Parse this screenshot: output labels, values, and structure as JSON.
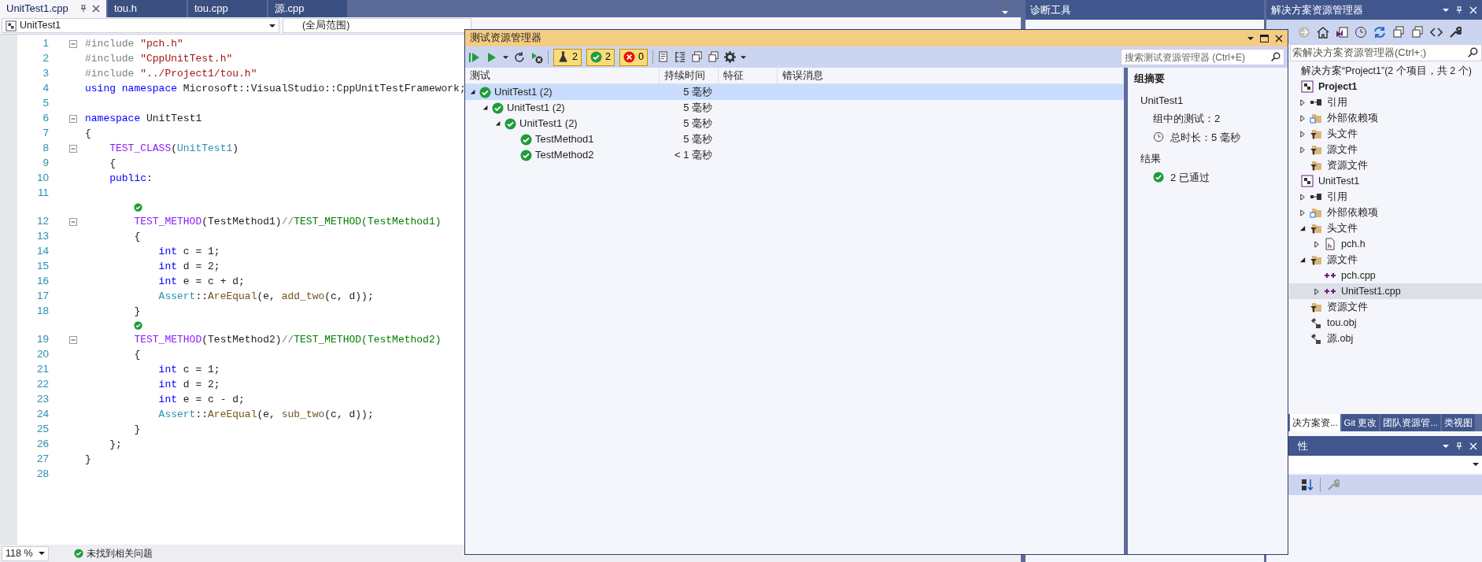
{
  "editor": {
    "tabs": [
      {
        "label": "UnitTest1.cpp",
        "selected": true
      },
      {
        "label": "tou.h",
        "selected": false
      },
      {
        "label": "tou.cpp",
        "selected": false
      },
      {
        "label": "源.cpp",
        "selected": false
      }
    ],
    "nav": {
      "project": "UnitTest1",
      "scope": "(全局范围)"
    },
    "lines": [
      {
        "number": "1",
        "fold": true,
        "tokens": [
          {
            "kind": "directive",
            "text": "#include "
          },
          {
            "kind": "string",
            "text": "\"pch.h\""
          }
        ]
      },
      {
        "number": "2",
        "tokens": [
          {
            "kind": "directive",
            "text": "#include "
          },
          {
            "kind": "string",
            "text": "\"CppUnitTest.h\""
          }
        ]
      },
      {
        "number": "3",
        "tokens": [
          {
            "kind": "directive",
            "text": "#include "
          },
          {
            "kind": "string",
            "text": "\"../Project1/tou.h\""
          }
        ]
      },
      {
        "number": "4",
        "tokens": [
          {
            "kind": "keyword",
            "text": "using"
          },
          {
            "kind": "keyword",
            "text": " namespace"
          },
          {
            "kind": "plain",
            "text": " Microsoft::VisualStudio::CppUnitTestFramework;"
          }
        ]
      },
      {
        "number": "5"
      },
      {
        "number": "6",
        "fold": true,
        "tokens": [
          {
            "kind": "keyword",
            "text": "namespace"
          },
          {
            "kind": "plain",
            "text": " UnitTest1"
          }
        ]
      },
      {
        "number": "7",
        "tokens": [
          {
            "kind": "plain",
            "text": "{"
          }
        ]
      },
      {
        "number": "8",
        "fold": true,
        "tokens": [
          {
            "kind": "macro",
            "text": "    TEST_CLASS"
          },
          {
            "kind": "plain",
            "text": "("
          },
          {
            "kind": "type",
            "text": "UnitTest1"
          },
          {
            "kind": "plain",
            "text": ")"
          }
        ]
      },
      {
        "number": "9",
        "tokens": [
          {
            "kind": "plain",
            "text": "    {"
          }
        ]
      },
      {
        "number": "10",
        "tokens": [
          {
            "kind": "keyword",
            "text": "    public"
          },
          {
            "kind": "plain",
            "text": ":"
          }
        ]
      },
      {
        "number": "11"
      },
      {
        "number": "12",
        "fold": true,
        "test_passed": true,
        "tokens": [
          {
            "kind": "macro",
            "text": "        TEST_METHOD"
          },
          {
            "kind": "plain",
            "text": "(TestMethod1)"
          },
          {
            "kind": "directive",
            "text": "//"
          },
          {
            "kind": "comment",
            "text": "TEST_METHOD(TestMethod1)"
          }
        ]
      },
      {
        "number": "13",
        "tokens": [
          {
            "kind": "plain",
            "text": "        {"
          }
        ]
      },
      {
        "number": "14",
        "tokens": [
          {
            "kind": "keyword",
            "text": "            int"
          },
          {
            "kind": "plain",
            "text": " c = 1;"
          }
        ]
      },
      {
        "number": "15",
        "tokens": [
          {
            "kind": "keyword",
            "text": "            int"
          },
          {
            "kind": "plain",
            "text": " d = 2;"
          }
        ]
      },
      {
        "number": "16",
        "tokens": [
          {
            "kind": "keyword",
            "text": "            int"
          },
          {
            "kind": "plain",
            "text": " e = c + d;"
          }
        ]
      },
      {
        "number": "17",
        "tokens": [
          {
            "kind": "type",
            "text": "            Assert"
          },
          {
            "kind": "plain",
            "text": "::"
          },
          {
            "kind": "function",
            "text": "AreEqual"
          },
          {
            "kind": "plain",
            "text": "(e, "
          },
          {
            "kind": "function",
            "text": "add_two"
          },
          {
            "kind": "plain",
            "text": "(c, d));"
          }
        ]
      },
      {
        "number": "18",
        "tokens": [
          {
            "kind": "plain",
            "text": "        }"
          }
        ]
      },
      {
        "number": "19",
        "fold": true,
        "test_passed": true,
        "tokens": [
          {
            "kind": "macro",
            "text": "        TEST_METHOD"
          },
          {
            "kind": "plain",
            "text": "(TestMethod2)"
          },
          {
            "kind": "directive",
            "text": "//"
          },
          {
            "kind": "comment",
            "text": "TEST_METHOD(TestMethod2)"
          }
        ]
      },
      {
        "number": "20",
        "tokens": [
          {
            "kind": "plain",
            "text": "        {"
          }
        ]
      },
      {
        "number": "21",
        "tokens": [
          {
            "kind": "keyword",
            "text": "            int"
          },
          {
            "kind": "plain",
            "text": " c = 1;"
          }
        ]
      },
      {
        "number": "22",
        "tokens": [
          {
            "kind": "keyword",
            "text": "            int"
          },
          {
            "kind": "plain",
            "text": " d = 2;"
          }
        ]
      },
      {
        "number": "23",
        "tokens": [
          {
            "kind": "keyword",
            "text": "            int"
          },
          {
            "kind": "plain",
            "text": " e = c - d;"
          }
        ]
      },
      {
        "number": "24",
        "tokens": [
          {
            "kind": "type",
            "text": "            Assert"
          },
          {
            "kind": "plain",
            "text": "::"
          },
          {
            "kind": "function",
            "text": "AreEqual"
          },
          {
            "kind": "plain",
            "text": "(e, "
          },
          {
            "kind": "function",
            "text": "sub_two"
          },
          {
            "kind": "plain",
            "text": "(c, d));"
          }
        ]
      },
      {
        "number": "25",
        "tokens": [
          {
            "kind": "plain",
            "text": "        }"
          }
        ]
      },
      {
        "number": "26",
        "tokens": [
          {
            "kind": "plain",
            "text": "    };"
          }
        ]
      },
      {
        "number": "27",
        "tokens": [
          {
            "kind": "plain",
            "text": "}"
          }
        ]
      },
      {
        "number": "28"
      }
    ],
    "zoom": "118 %",
    "issues": "未找到相关问题"
  },
  "diagnostics": {
    "title": "诊断工具"
  },
  "test_explorer": {
    "title": "测试资源管理器",
    "counters": [
      {
        "kind": "total",
        "count": "2",
        "selected": true
      },
      {
        "kind": "passed",
        "count": "2",
        "selected": true
      },
      {
        "kind": "failed",
        "count": "0",
        "selected": true
      }
    ],
    "search": {
      "placeholder": "搜索测试资源管理器 (Ctrl+E)"
    },
    "columns": [
      "测试",
      "持续时间",
      "特征",
      "错误消息"
    ],
    "tests": [
      {
        "name": "UnitTest1 (2)",
        "duration": "5 毫秒",
        "passed": true,
        "expanded": true,
        "selected": true,
        "children": [
          {
            "name": "UnitTest1 (2)",
            "duration": "5 毫秒",
            "passed": true,
            "expanded": true,
            "selected": false,
            "children": [
              {
                "name": "UnitTest1 (2)",
                "duration": "5 毫秒",
                "passed": true,
                "expanded": true,
                "selected": false,
                "children": [
                  {
                    "name": "TestMethod1",
                    "duration": "5 毫秒",
                    "passed": true,
                    "selected": false
                  },
                  {
                    "name": "TestMethod2",
                    "duration": "< 1 毫秒",
                    "passed": true,
                    "selected": false
                  }
                ]
              }
            ]
          }
        ]
      }
    ],
    "summary": {
      "heading": "组摘要",
      "group": "UnitTest1",
      "count": "组中的测试：2",
      "duration": "总时长：5 毫秒",
      "results_heading": "结果",
      "results": [
        {
          "passed": true,
          "text": "2 已通过"
        }
      ]
    }
  },
  "solution_explorer": {
    "title": "解决方案资源管理器",
    "search": {
      "placeholder": "索解决方案资源管理器(Ctrl+;)"
    },
    "tree": [
      {
        "label": "解决方案“Project1”(2 个项目，共 2 个)",
        "selected": false,
        "children": [
          {
            "label": "Project1",
            "kind": "project",
            "startup": true,
            "selected": false,
            "children": [
              {
                "label": "引用",
                "kind": "references",
                "expanded": false,
                "selected": false
              },
              {
                "label": "外部依赖项",
                "kind": "external",
                "expanded": false,
                "selected": false
              },
              {
                "label": "头文件",
                "kind": "filter",
                "expanded": false,
                "selected": false
              },
              {
                "label": "源文件",
                "kind": "filter",
                "expanded": false,
                "selected": false
              },
              {
                "label": "资源文件",
                "kind": "filter",
                "selected": false
              }
            ]
          },
          {
            "label": "UnitTest1",
            "kind": "project",
            "startup": false,
            "selected": false,
            "children": [
              {
                "label": "引用",
                "kind": "references",
                "expanded": false,
                "selected": false
              },
              {
                "label": "外部依赖项",
                "kind": "external",
                "expanded": false,
                "selected": false
              },
              {
                "label": "头文件",
                "kind": "filter",
                "expanded": true,
                "selected": false,
                "children": [
                  {
                    "label": "pch.h",
                    "kind": "header",
                    "expanded": false,
                    "selected": false
                  }
                ]
              },
              {
                "label": "源文件",
                "kind": "filter",
                "expanded": true,
                "selected": false,
                "children": [
                  {
                    "label": "pch.cpp",
                    "kind": "cpp",
                    "selected": false
                  },
                  {
                    "label": "UnitTest1.cpp",
                    "kind": "cpp",
                    "expanded": false,
                    "selected": true
                  }
                ]
              },
              {
                "label": "资源文件",
                "kind": "filter",
                "selected": false
              },
              {
                "label": "tou.obj",
                "kind": "obj",
                "selected": false
              },
              {
                "label": "源.obj",
                "kind": "obj",
                "selected": false
              }
            ]
          }
        ]
      }
    ],
    "bottom_tabs": [
      {
        "label": "决方案资...",
        "selected": true
      },
      {
        "label": "Git 更改",
        "selected": false
      },
      {
        "label": "团队资源管...",
        "selected": false
      },
      {
        "label": "类视图",
        "selected": false
      }
    ]
  },
  "properties": {
    "title": "性"
  }
}
